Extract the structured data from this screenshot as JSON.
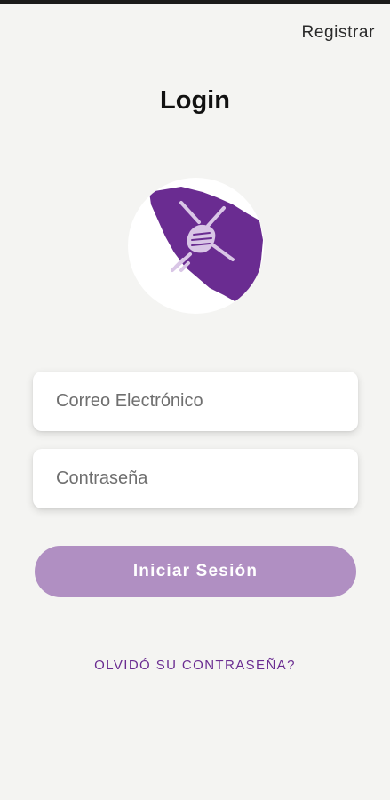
{
  "header": {
    "register_label": "Registrar"
  },
  "title": "Login",
  "logo": {
    "icon": "hands-map-logo",
    "color": "#6a2c91"
  },
  "form": {
    "email_placeholder": "Correo Electrónico",
    "email_value": "",
    "password_placeholder": "Contraseña",
    "password_value": "",
    "submit_label": "Iniciar Sesión"
  },
  "forgot_label": "OLVIDÓ SU CONTRASEÑA?",
  "colors": {
    "background": "#f4f4f2",
    "accent": "#6a2c91",
    "button": "#b08fc2"
  }
}
